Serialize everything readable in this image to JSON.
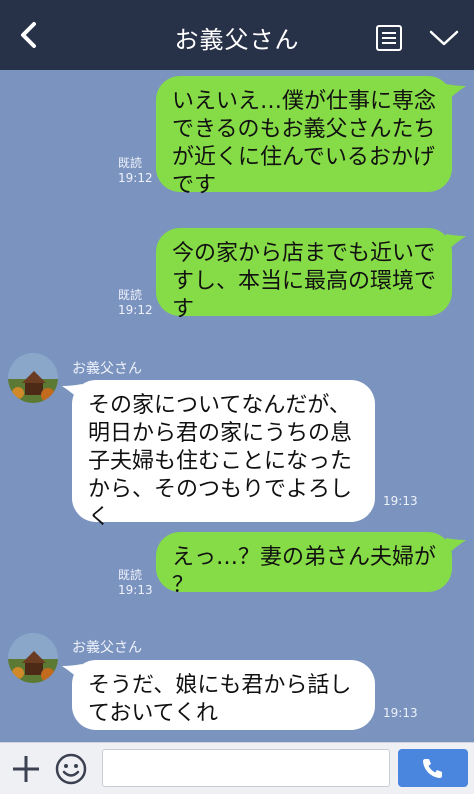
{
  "header": {
    "title": "お義父さん",
    "back_icon": "chevron-left-icon",
    "menu_icon": "notes-menu-icon",
    "expand_icon": "chevron-down-icon"
  },
  "messages": [
    {
      "from": "me",
      "text": "いえいえ…僕が仕事に専念\nできるのもお義父さんたち\nが近くに住んでいるおかげ\nです",
      "read_label": "既読",
      "time": "19:12"
    },
    {
      "from": "me",
      "text": "今の家から店までも近いで\nすし、本当に最高の環境で\nす",
      "read_label": "既読",
      "time": "19:12"
    },
    {
      "from": "them",
      "sender": "お義父さん",
      "text": "その家についてなんだが、\n明日から君の家にうちの息\n子夫婦も住むことになった\nから、そのつもりでよろし\nく",
      "time": "19:13"
    },
    {
      "from": "me",
      "text": "えっ…？妻の弟さん夫婦が\n？",
      "read_label": "既読",
      "time": "19:13"
    },
    {
      "from": "them",
      "sender": "お義父さん",
      "text": "そうだ、娘にも君から話し\nておいてくれ",
      "time": "19:13"
    }
  ],
  "footer": {
    "input_placeholder": "",
    "plus_icon": "plus-icon",
    "sticker_icon": "smile-icon",
    "call_icon": "phone-icon"
  },
  "colors": {
    "header_bg": "#273148",
    "chat_bg": "#7b93bf",
    "my_bubble": "#86dc46",
    "their_bubble": "#ffffff",
    "call_button": "#4b86de"
  }
}
